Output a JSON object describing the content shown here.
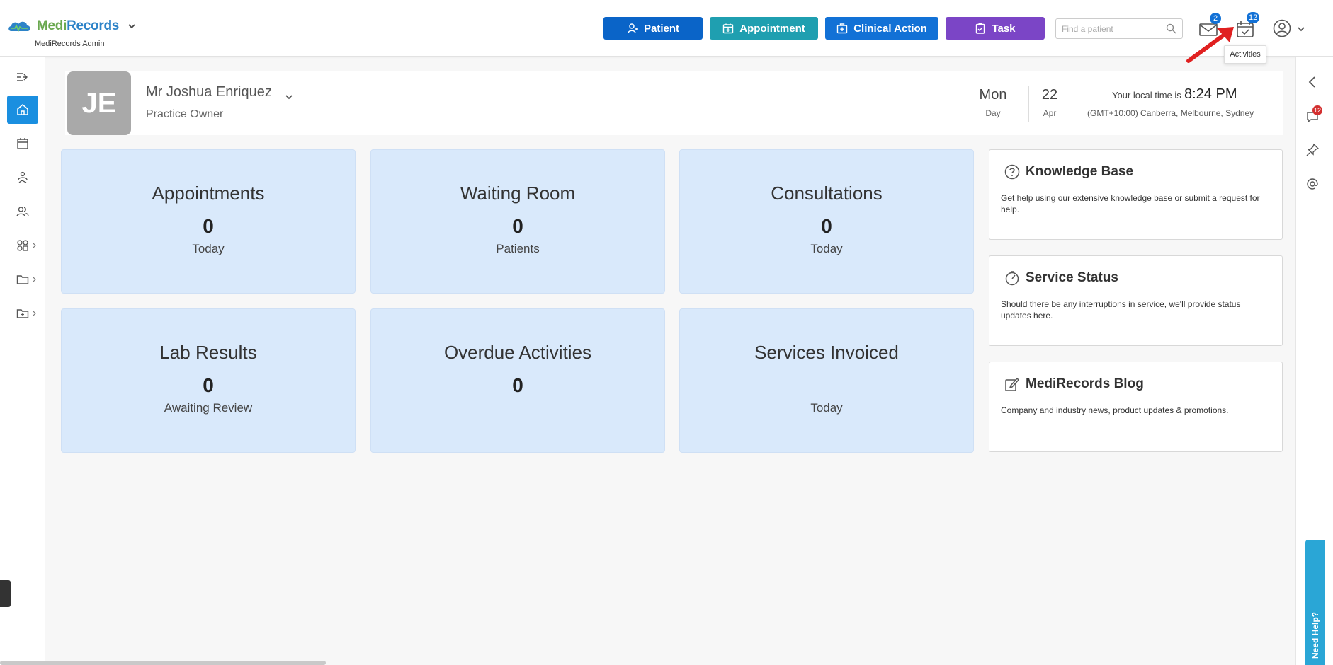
{
  "brand": {
    "name_part1": "Medi",
    "name_part2": "Records",
    "subtitle": "MediRecords Admin"
  },
  "header": {
    "buttons": [
      {
        "label": "Patient",
        "icon": "person-plus-icon",
        "color": "#0a64c8"
      },
      {
        "label": "Appointment",
        "icon": "calendar-plus-icon",
        "color": "#1f9fb0"
      },
      {
        "label": "Clinical Action",
        "icon": "medical-case-icon",
        "color": "#1271d6"
      },
      {
        "label": "Task",
        "icon": "clipboard-icon",
        "color": "#7b45c6"
      }
    ],
    "search_placeholder": "Find a patient",
    "messages_count": "2",
    "activities_count": "12",
    "activities_tooltip": "Activities"
  },
  "profile": {
    "initials": "JE",
    "name": "Mr Joshua Enriquez",
    "role": "Practice Owner",
    "day_value": "Mon",
    "day_label": "Day",
    "date_value": "22",
    "date_label": "Apr",
    "local_time_label": "Your local time is",
    "local_time": "8:24 PM",
    "timezone": "(GMT+10:00) Canberra, Melbourne, Sydney"
  },
  "cards": [
    {
      "title": "Appointments",
      "value": "0",
      "sub": "Today"
    },
    {
      "title": "Waiting Room",
      "value": "0",
      "sub": "Patients"
    },
    {
      "title": "Consultations",
      "value": "0",
      "sub": "Today"
    },
    {
      "title": "Lab Results",
      "value": "0",
      "sub": "Awaiting Review"
    },
    {
      "title": "Overdue Activities",
      "value": "0",
      "sub": ""
    },
    {
      "title": "Services Invoiced",
      "value": "",
      "sub": "Today"
    }
  ],
  "panels": [
    {
      "title": "Knowledge Base",
      "text": "Get help using our extensive knowledge base or submit a request for help."
    },
    {
      "title": "Service Status",
      "text": "Should there be any interruptions in service, we'll provide status updates here."
    },
    {
      "title": "MediRecords Blog",
      "text": "Company and industry news, product updates & promotions."
    }
  ],
  "right_sidebar": {
    "chat_count": "12",
    "need_help_label": "Need Help?"
  },
  "colors": {
    "accent": "#1a8fe0",
    "card_bg": "#d9e9fb",
    "brand_green": "#6aa84f",
    "brand_blue": "#2d83c8"
  }
}
